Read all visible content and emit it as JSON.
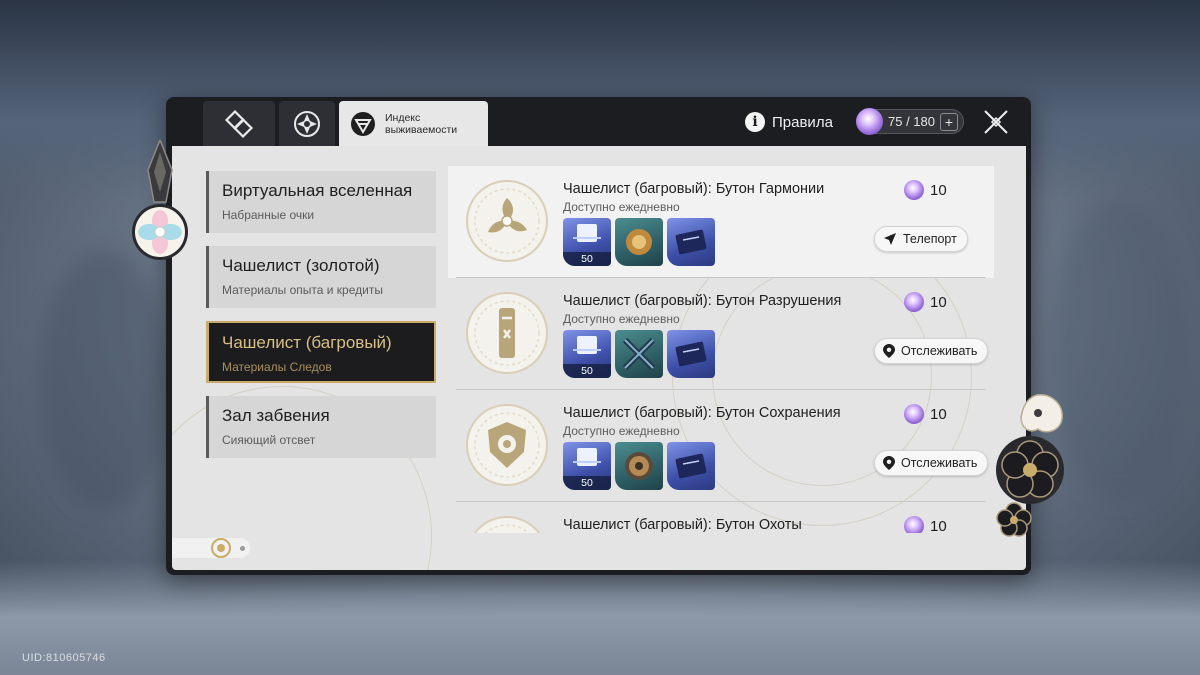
{
  "uid": "UID:810605746",
  "header": {
    "tabs": [
      {
        "icon": "sim-universe-icon"
      },
      {
        "icon": "calyx-icon"
      },
      {
        "icon": "survival-index-icon",
        "label": "Индекс выживаемости"
      }
    ],
    "rules_label": "Правила",
    "stamina": {
      "value": "75 / 180",
      "plus": "+"
    }
  },
  "menu": [
    {
      "title": "Виртуальная вселенная",
      "subtitle": "Набранные очки",
      "active": false
    },
    {
      "title": "Чашелист (золотой)",
      "subtitle": "Материалы опыта и кредиты",
      "active": false
    },
    {
      "title": "Чашелист (багровый)",
      "subtitle": "Материалы Следов",
      "active": true
    },
    {
      "title": "Зал забвения",
      "subtitle": "Сияющий отсвет",
      "active": false
    }
  ],
  "entries": [
    {
      "title": "Чашелист (багровый): Бутон Гармонии",
      "subtitle": "Доступно ежедневно",
      "cost": "10",
      "action": "Телепорт",
      "action_icon": "navigate-arrow-icon",
      "reward_qty": "50",
      "rewards": [
        "exp-material-icon",
        "harmony-material-icon",
        "trace-book-icon"
      ]
    },
    {
      "title": "Чашелист (багровый): Бутон Разрушения",
      "subtitle": "Доступно ежедневно",
      "cost": "10",
      "action": "Отслеживать",
      "action_icon": "map-pin-icon",
      "reward_qty": "50",
      "rewards": [
        "exp-material-icon",
        "destruction-material-icon",
        "trace-book-icon"
      ]
    },
    {
      "title": "Чашелист (багровый): Бутон Сохранения",
      "subtitle": "Доступно ежедневно",
      "cost": "10",
      "action": "Отслеживать",
      "action_icon": "map-pin-icon",
      "reward_qty": "50",
      "rewards": [
        "exp-material-icon",
        "preservation-material-icon",
        "trace-book-icon"
      ]
    },
    {
      "title": "Чашелист (багровый): Бутон Охоты",
      "subtitle": "",
      "cost": "10"
    }
  ],
  "colors": {
    "accent_gold": "#c9ab6a",
    "panel_dark": "#1c1d21",
    "panel_light": "#e4e4e4"
  }
}
